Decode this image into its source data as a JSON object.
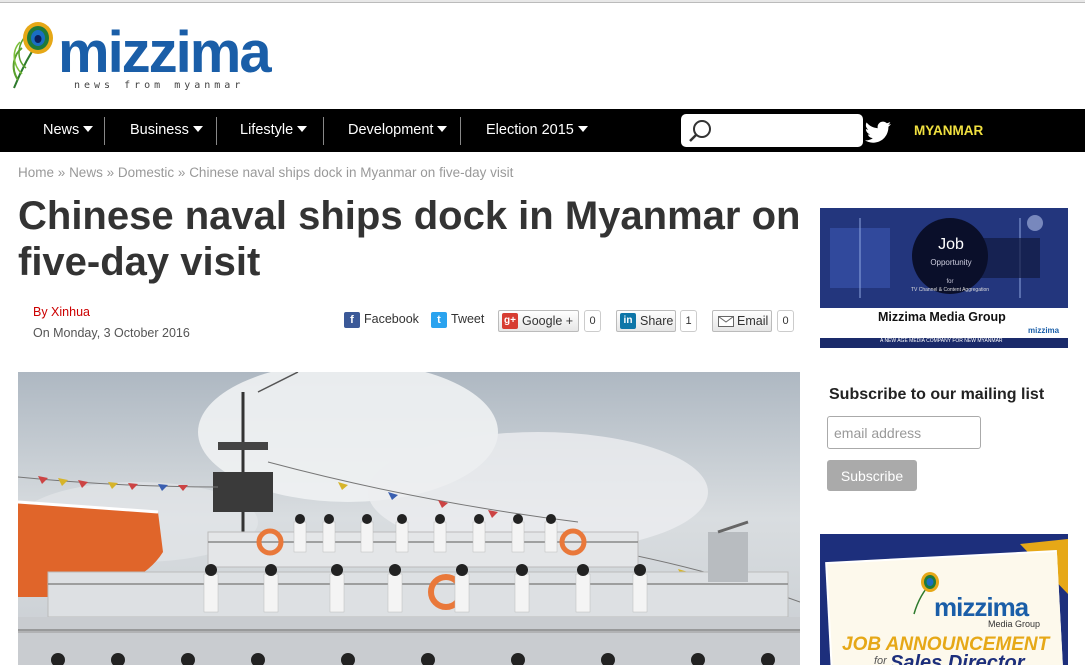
{
  "header": {
    "logo_text": "mizzima",
    "logo_tagline": "news from myanmar"
  },
  "nav": {
    "items": [
      "News",
      "Business",
      "Lifestyle",
      "Development",
      "Election 2015"
    ],
    "search_placeholder": "",
    "language": "MYANMAR"
  },
  "breadcrumb": {
    "home": "Home",
    "news": "News",
    "domestic": "Domestic",
    "current": "Chinese naval ships dock in Myanmar on five-day visit",
    "separator": "»"
  },
  "article": {
    "title": "Chinese naval ships dock in Myanmar on five-day visit",
    "byline": "By Xinhua",
    "date": "On Monday, 3 October 2016"
  },
  "share": {
    "facebook": "Facebook",
    "tweet": "Tweet",
    "google": "Google +",
    "google_count": "0",
    "linkedin": "Share",
    "linkedin_count": "1",
    "email": "Email",
    "email_count": "0"
  },
  "sidebar": {
    "ad1": {
      "job": "Job",
      "opportunity": "Opportunity",
      "for": "for",
      "role": "TV Channel & Content Aggregation",
      "company": "Mizzima Media Group",
      "footer": "A NEW AGE MEDIA COMPANY FOR NEW MYANMAR",
      "brand": "mizzima"
    },
    "subscribe_title": "Subscribe to our mailing list",
    "email_placeholder": "email address",
    "subscribe_label": "Subscribe",
    "ad2": {
      "brand": "mizzima",
      "brand_sub": "Media Group",
      "headline": "JOB ANNOUNCEMENT",
      "subline_prefix": "for",
      "subline": "Sales Director"
    }
  },
  "colors": {
    "brand_blue": "#1a5ea8",
    "nav_bg": "#000000",
    "language_yellow": "#f0e040",
    "byline_red": "#cc0000"
  }
}
